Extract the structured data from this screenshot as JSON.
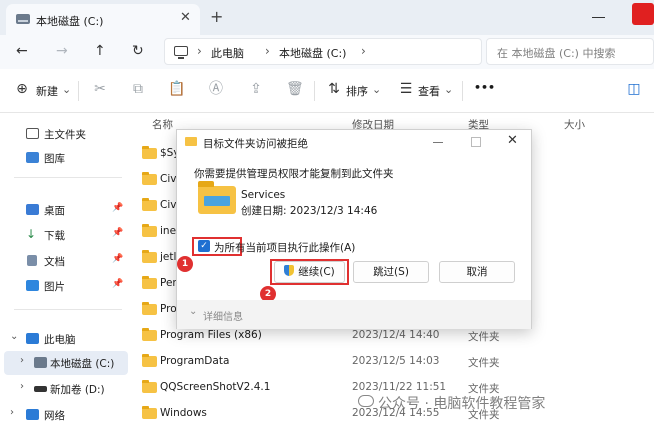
{
  "window": {
    "tab_title": "本地磁盘 (C:)",
    "tab_close": "✕",
    "tab_add": "+"
  },
  "nav": {
    "back": "←",
    "forward": "→",
    "up": "↑",
    "refresh": "↻"
  },
  "address": {
    "crumbs": [
      "此电脑",
      "本地磁盘 (C:)"
    ],
    "separator": "›"
  },
  "search": {
    "placeholder": "在 本地磁盘 (C:) 中搜索"
  },
  "commandbar": {
    "new_label": "新建",
    "sort_label": "排序",
    "view_label": "查看",
    "more": "•••"
  },
  "sidebar": {
    "items": [
      {
        "label": "主文件夹"
      },
      {
        "label": "图库"
      },
      {
        "label": "桌面"
      },
      {
        "label": "下载"
      },
      {
        "label": "文档"
      },
      {
        "label": "图片"
      },
      {
        "label": "此电脑"
      },
      {
        "label": "本地磁盘 (C:)"
      },
      {
        "label": "新加卷 (D:)"
      },
      {
        "label": "网络"
      }
    ]
  },
  "filelist": {
    "columns": {
      "name": "名称",
      "date": "修改日期",
      "type": "类型",
      "size": "大小"
    },
    "rows": [
      {
        "name": "$Sy",
        "date": "",
        "type": ""
      },
      {
        "name": "Civ",
        "date": "",
        "type": ""
      },
      {
        "name": "Civ",
        "date": "",
        "type": ""
      },
      {
        "name": "ine",
        "date": "",
        "type": ""
      },
      {
        "name": "jetl",
        "date": "",
        "type": ""
      },
      {
        "name": "Per",
        "date": "",
        "type": ""
      },
      {
        "name": "Pro",
        "date": "",
        "type": ""
      },
      {
        "name": "Program Files (x86)",
        "date": "2023/12/4 14:40",
        "type": "文件夹"
      },
      {
        "name": "ProgramData",
        "date": "2023/12/5 14:03",
        "type": "文件夹"
      },
      {
        "name": "QQScreenShotV2.4.1",
        "date": "2023/11/22 11:51",
        "type": "文件夹"
      },
      {
        "name": "Windows",
        "date": "2023/12/4 14:55",
        "type": "文件夹"
      }
    ]
  },
  "dialog": {
    "title": "目标文件夹访问被拒绝",
    "message": "你需要提供管理员权限才能复制到此文件夹",
    "folder_name": "Services",
    "folder_date": "创建日期: 2023/12/3 14:46",
    "checkbox_label": "为所有当前项目执行此操作(A)",
    "continue_label": "继续(C)",
    "skip_label": "跳过(S)",
    "cancel_label": "取消",
    "details_label": "详细信息",
    "badge1": "1",
    "badge2": "2",
    "close": "✕"
  },
  "watermark": {
    "text": "公众号 · 电脑软件教程管家"
  },
  "colors": {
    "accent": "#1f6fd1",
    "highlight": "#e03030",
    "folder": "#f6c244"
  }
}
